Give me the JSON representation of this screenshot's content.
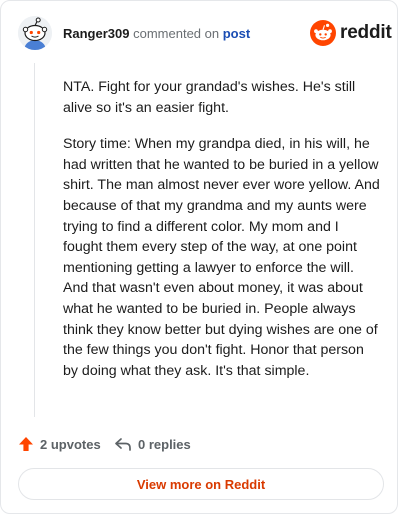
{
  "comment": {
    "username": "Ranger309",
    "verb": "commented on",
    "post_link": "post",
    "paragraphs": [
      "NTA. Fight for your grandad's wishes. He's still alive so it's an easier fight.",
      "Story time: When my grandpa died, in his will, he had written that he wanted to be buried in a yellow shirt. The man almost never ever wore yellow. And because of that my grandma and my aunts were trying to find a different color. My mom and I fought them every step of the way, at one point mentioning getting a lawyer to enforce the will. And that wasn't even about money, it was about what he wanted to be buried in. People always think they know better but dying wishes are one of the few things you don't fight. Honor that person by doing what they ask. It's that simple."
    ]
  },
  "brand": {
    "name": "reddit",
    "color": "#ff4500",
    "logo_icon": "reddit-snoo-icon"
  },
  "actions": {
    "upvotes": "2 upvotes",
    "replies": "0 replies",
    "upvote_icon": "upvote-arrow-icon",
    "reply_icon": "reply-arrow-icon"
  },
  "footer": {
    "view_more": "View more on Reddit",
    "accent": "#d93a00"
  }
}
